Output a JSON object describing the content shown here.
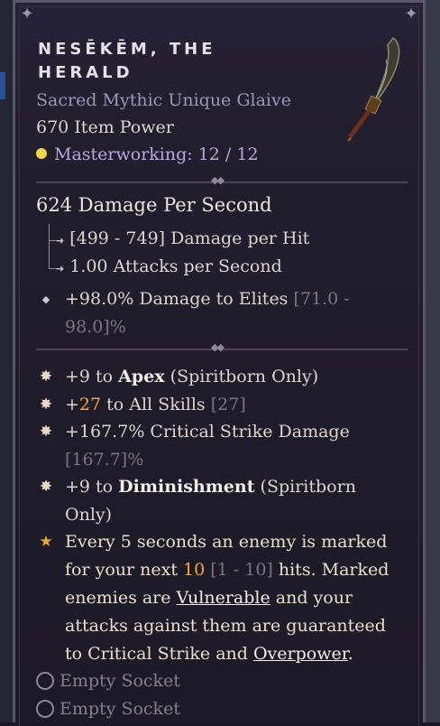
{
  "item": {
    "name_line1": "NESĒKĒM, THE",
    "name_line2": "HERALD",
    "type": "Sacred Mythic Unique Glaive",
    "item_power": "670 Item Power",
    "masterworking": "Masterworking: 12 / 12"
  },
  "weapon": {
    "dps": "624 Damage Per Second",
    "damage_per_hit": "[499 - 749] Damage per Hit",
    "attacks_per_second": "1.00 Attacks per Second"
  },
  "implicit": {
    "value": "+98.0% Damage to Elites ",
    "range_a": "[71.0 -",
    "range_b": "98.0]%"
  },
  "affixes": {
    "a1_pre": "+9 to ",
    "a1_bold": "Apex",
    "a1_post": " (Spiritborn Only)",
    "a2_pre": "+",
    "a2_num": "27",
    "a2_post": " to All Skills ",
    "a2_range": "[27]",
    "a3_text": "+167.7% Critical Strike Damage",
    "a3_range": "[167.7]%",
    "a4_pre": "+9 to ",
    "a4_bold": "Diminishment",
    "a4_post": " (Spiritborn",
    "a4_line2": "Only)"
  },
  "unique": {
    "l1": "Every 5 seconds an enemy is marked",
    "l2_pre": "for your next ",
    "l2_num": "10",
    "l2_range": " [1 - 10]",
    "l2_post": " hits. Marked",
    "l3_pre": "enemies are ",
    "l3_link": "Vulnerable",
    "l3_post": " and your",
    "l4": "attacks against them are guaranteed",
    "l5_pre": "to Critical Strike and ",
    "l5_link": "Overpower",
    "l5_post": "."
  },
  "sockets": [
    "Empty Socket",
    "Empty Socket"
  ],
  "colors": {
    "accent_purple": "#b9a7e0",
    "gold_dot": "#f0d743",
    "orange_value": "#f0a64a",
    "background": "#1d1a27"
  },
  "icons": [
    "masterwork-dot-icon",
    "arrow-right-icon",
    "diamond-bullet-icon",
    "burst-bullet-icon",
    "legendary-star-icon",
    "socket-ring-icon",
    "glaive-icon"
  ]
}
